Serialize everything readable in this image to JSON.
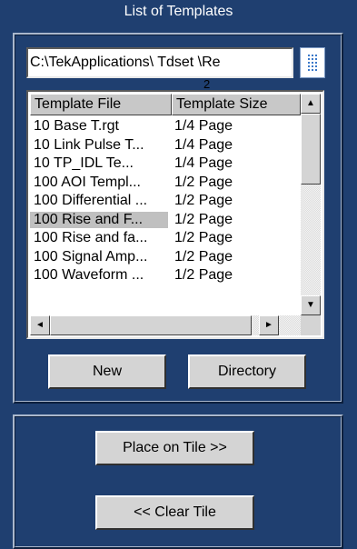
{
  "window": {
    "title": "List of Templates"
  },
  "path_field": {
    "value": "C:\\TekApplications\\  Tdset   \\Re"
  },
  "annotation": "2",
  "columns": [
    "Template File",
    "Template Size"
  ],
  "rows": [
    {
      "file": "10 Base T.rgt",
      "size": "1/4 Page",
      "selected": false
    },
    {
      "file": "10 Link Pulse T...",
      "size": "1/4 Page",
      "selected": false
    },
    {
      "file": "10 TP_IDL Te...",
      "size": "1/4 Page",
      "selected": false
    },
    {
      "file": "100  AOI Templ...",
      "size": "1/2 Page",
      "selected": false
    },
    {
      "file": "100 Differential ...",
      "size": "1/2 Page",
      "selected": false
    },
    {
      "file": "100 Rise and F...",
      "size": "1/2 Page",
      "selected": true
    },
    {
      "file": "100 Rise and fa...",
      "size": "1/2 Page",
      "selected": false
    },
    {
      "file": "100 Signal Amp...",
      "size": "1/2 Page",
      "selected": false
    },
    {
      "file": "100 Waveform ...",
      "size": "1/2 Page",
      "selected": false
    }
  ],
  "buttons": {
    "new": "New",
    "directory": "Directory",
    "place_on_tile": "Place on Tile >>",
    "clear_tile": "<< Clear Tile"
  },
  "icons": {
    "scroll_up": "▲",
    "scroll_down": "▼",
    "scroll_left": "◄",
    "scroll_right": "►"
  },
  "colors": {
    "background": "#1f3f70",
    "selection": "#c0c0c0",
    "button_face": "#d4d4d4",
    "browse_icon": "#3a78c9"
  }
}
